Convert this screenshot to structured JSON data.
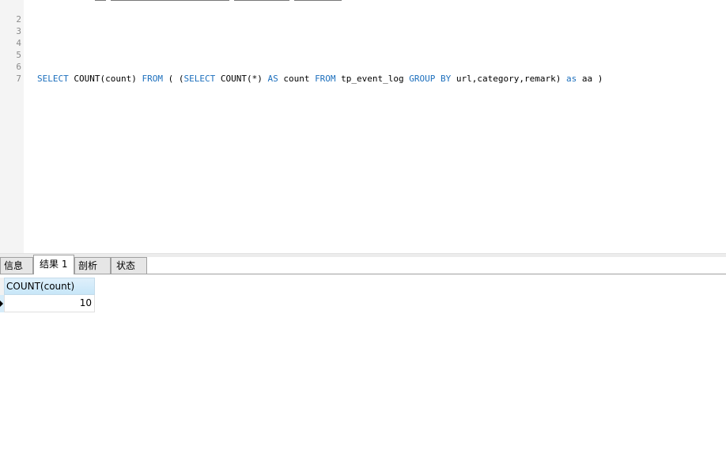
{
  "editor": {
    "lines": [
      {
        "number": "2",
        "text": ""
      },
      {
        "number": "3",
        "text": ""
      },
      {
        "number": "4",
        "text": ""
      },
      {
        "number": "5",
        "text": ""
      },
      {
        "number": "6",
        "text": "SELECT COUNT(count) FROM ( (SELECT COUNT(*) AS count FROM tp_event_log GROUP BY url,category,remark) as aa )"
      },
      {
        "number": "7",
        "text": ""
      }
    ],
    "query_tokens": {
      "t1": "SELECT",
      "t2": " COUNT(count) ",
      "t3": "FROM",
      "t4": " ( (",
      "t5": "SELECT",
      "t6": " COUNT(*) ",
      "t7": "AS",
      "t8": " count ",
      "t9": "FROM",
      "t10": " tp_event_log ",
      "t11": "GROUP BY",
      "t12": " url,category,remark) ",
      "t13": "as",
      "t14": " aa )"
    },
    "colors": {
      "keyword": "#1c6fbd",
      "text": "#000000",
      "line_number": "#8a8a8a"
    }
  },
  "tabs": [
    {
      "label": "信息",
      "active": false
    },
    {
      "label": "结果 1",
      "active": true
    },
    {
      "label": "剖析",
      "active": false
    },
    {
      "label": "状态",
      "active": false
    }
  ],
  "result": {
    "columns": [
      "COUNT(count)"
    ],
    "rows": [
      [
        "10"
      ]
    ]
  }
}
